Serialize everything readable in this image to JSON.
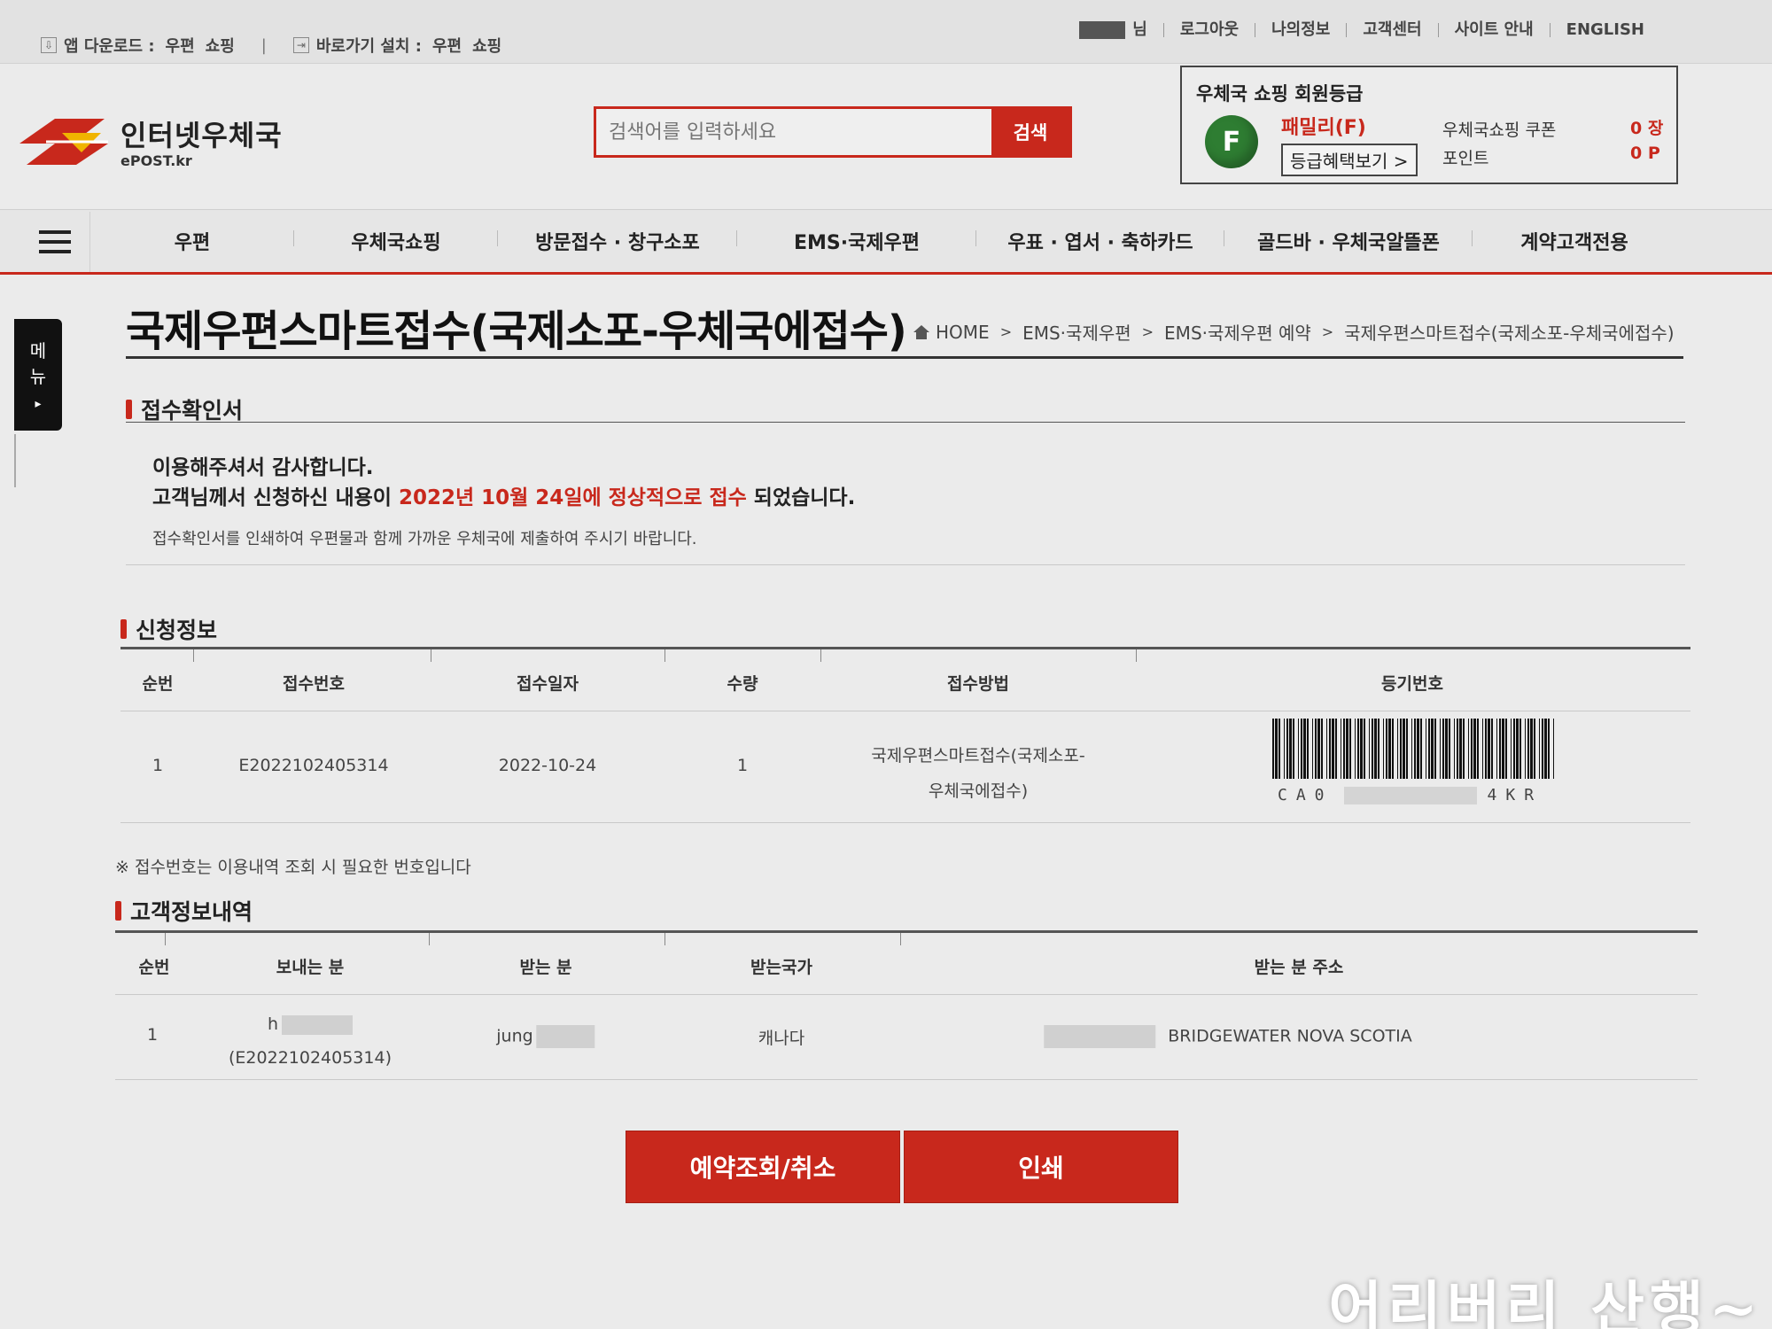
{
  "util_bar": {
    "app_download_label": "앱 다운로드 :",
    "app_link1": "우편",
    "app_link2": "쇼핑",
    "shortcut_label": "바로가기 설치 :",
    "shortcut_link1": "우편",
    "shortcut_link2": "쇼핑",
    "user_suffix": "님",
    "logout": "로그아웃",
    "my_info": "나의정보",
    "customer_center": "고객센터",
    "site_guide": "사이트 안내",
    "english": "ENGLISH"
  },
  "logo": {
    "ko": "인터넷우체국",
    "en": "ePOST.kr",
    "accent": "#c8281c"
  },
  "search": {
    "placeholder": "검색어를 입력하세요",
    "button": "검색"
  },
  "member": {
    "title": "우체국 쇼핑 회원등급",
    "grade_letter": "F",
    "grade_name": "패밀리(F)",
    "benefit_button": "등급혜택보기 >",
    "coupon_label": "우체국쇼핑 쿠폰",
    "coupon_value": "0 장",
    "point_label": "포인트",
    "point_value": "0 P"
  },
  "gnb": {
    "items": [
      "우편",
      "우체국쇼핑",
      "방문접수 · 창구소포",
      "EMS·국제우편",
      "우표 · 엽서 · 축하카드",
      "골드바 · 우체국알뜰폰",
      "계약고객전용"
    ]
  },
  "side_tab": {
    "label1": "메",
    "label2": "뉴",
    "arrow": "▸"
  },
  "page": {
    "title": "국제우편스마트접수(국제소포-우체국에접수)",
    "breadcrumb": [
      "HOME",
      "EMS·국제우편",
      "EMS·국제우편 예약",
      "국제우편스마트접수(국제소포-우체국에접수)"
    ]
  },
  "confirm": {
    "section_title": "접수확인서",
    "line1": "이용해주셔서 감사합니다.",
    "line2_pre": "고객님께서 신청하신 내용이 ",
    "line2_red": "2022년 10월 24일에 정상적으로 접수",
    "line2_post": " 되었습니다.",
    "line3": "접수확인서를 인쇄하여 우편물과 함께 가까운 우체국에 제출하여 주시기 바랍니다."
  },
  "application": {
    "section_title": "신청정보",
    "headers": [
      "순번",
      "접수번호",
      "접수일자",
      "수량",
      "접수방법",
      "등기번호"
    ],
    "row": {
      "seq": "1",
      "receipt_no": "E2022102405314",
      "date": "2022-10-24",
      "qty": "1",
      "method_line1": "국제우편스마트접수(국제소포-",
      "method_line2": "우체국에접수)",
      "reg_prefix": "CA0",
      "reg_suffix": "4KR"
    },
    "note": "※ 접수번호는 이용내역 조회 시 필요한 번호입니다"
  },
  "customer": {
    "section_title": "고객정보내역",
    "headers": [
      "순번",
      "보내는 분",
      "받는 분",
      "받는국가",
      "받는 분 주소"
    ],
    "row": {
      "seq": "1",
      "sender_prefix": "h",
      "sender_receipt": "(E2022102405314)",
      "receiver_prefix": "jung",
      "country": "캐나다",
      "address": "BRIDGEWATER  NOVA SCOTIA"
    }
  },
  "buttons": {
    "inquire_cancel": "예약조회/취소",
    "print": "인쇄"
  },
  "watermark": "어리버리 산행~"
}
